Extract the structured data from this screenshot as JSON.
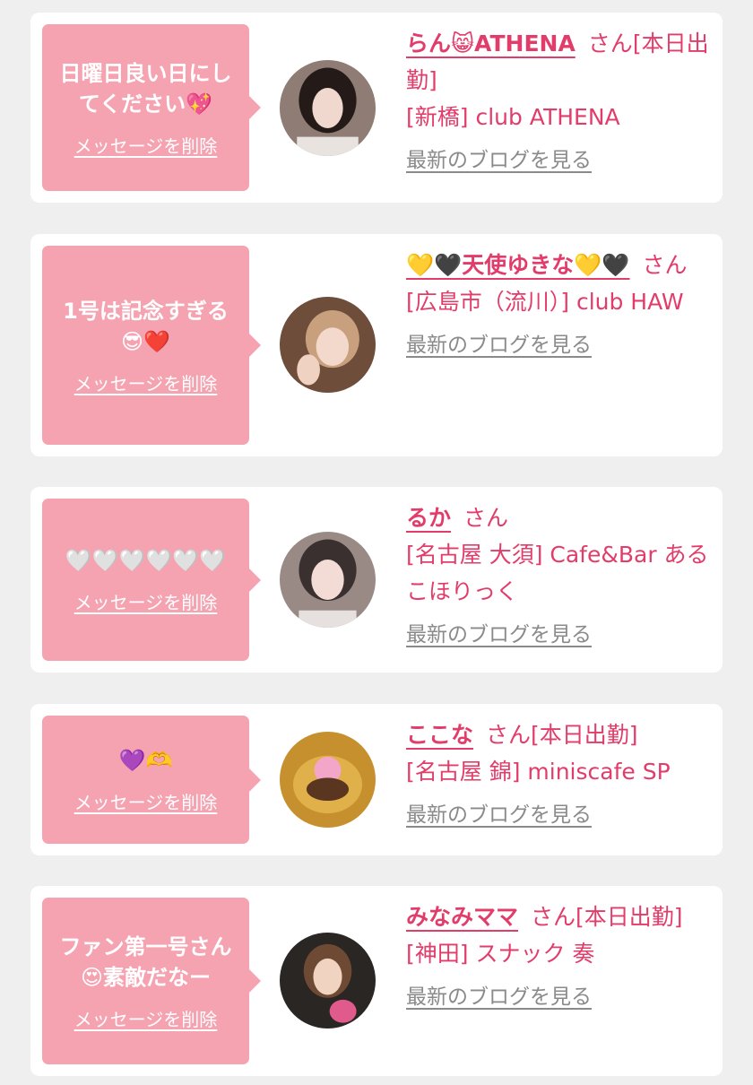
{
  "delete_label": "メッセージを削除",
  "blog_label": "最新のブログを見る",
  "honorific": "さん",
  "colors": {
    "background": "#efefef",
    "bubble": "#f5a3b1",
    "accent_pink": "#e23d6a",
    "link_gray": "#8a8a8a"
  },
  "entries": [
    {
      "message": "日曜日良い日にしてください💖",
      "name": "らん😸ATHENA",
      "status": "[本日出勤]",
      "shop": "[新橋] club ATHENA"
    },
    {
      "message": "1号は記念すぎる😎❤️",
      "name": "💛🖤天使ゆきな💛🖤",
      "status": "",
      "shop": "[広島市（流川）] club HAW"
    },
    {
      "message": "🤍🤍🤍🤍🤍🤍",
      "name": "るか",
      "status": "",
      "shop": "[名古屋 大須] Cafe&Bar あるこほりっく"
    },
    {
      "message": "💜🫶",
      "name": "ここな",
      "status": "[本日出勤]",
      "shop": "[名古屋 錦] miniscafe SP"
    },
    {
      "message": "ファン第一号さん😍素敵だなー",
      "name": "みなみママ",
      "status": "[本日出勤]",
      "shop": "[神田] スナック 奏"
    }
  ]
}
